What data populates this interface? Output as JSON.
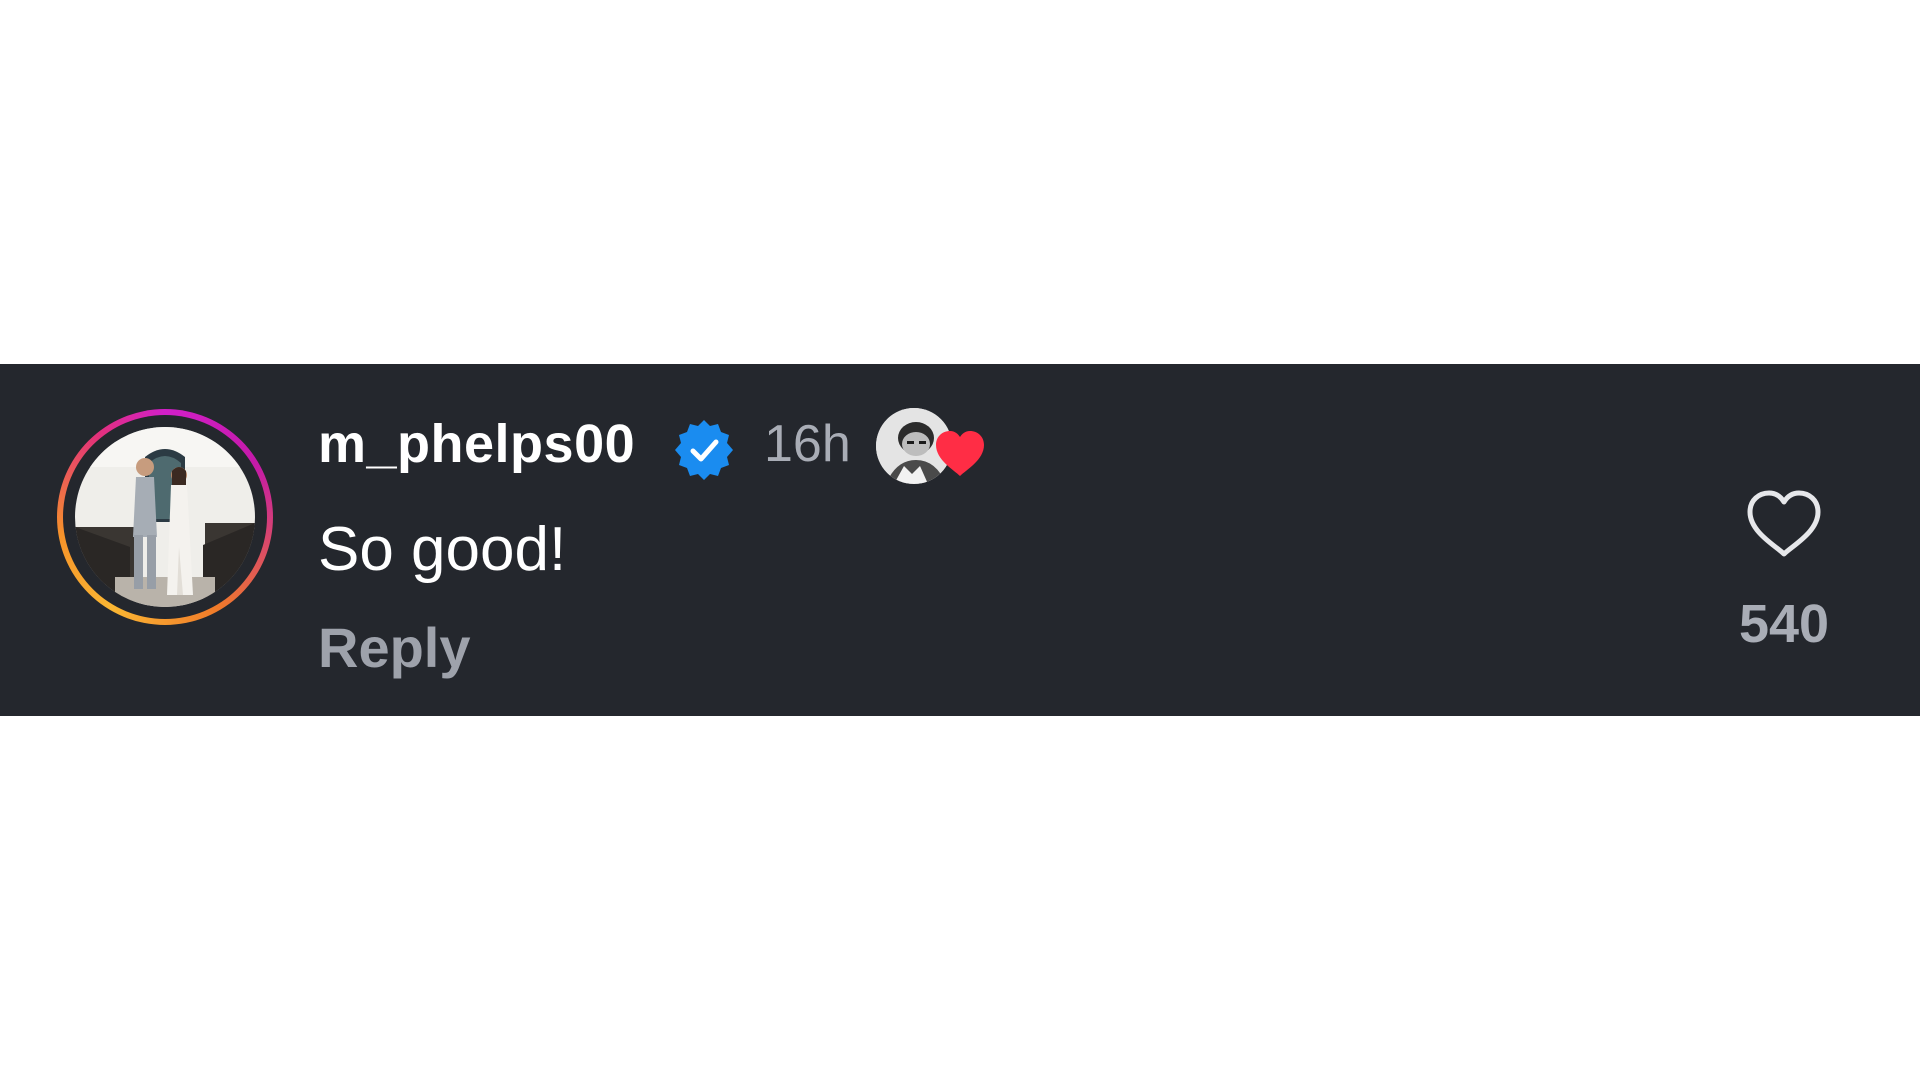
{
  "comment": {
    "username": "m_phelps00",
    "verified_icon": "verified-badge-icon",
    "timestamp": "16h",
    "text": "So good!",
    "reply_label": "Reply",
    "liked_by_author_icon": "heart-icon",
    "like_icon": "heart-outline-icon",
    "like_count": "540"
  },
  "colors": {
    "background": "#24272d",
    "verified_blue": "#1a8cf0",
    "liked_red": "#ff2d45",
    "muted_text": "#a9adb6"
  }
}
